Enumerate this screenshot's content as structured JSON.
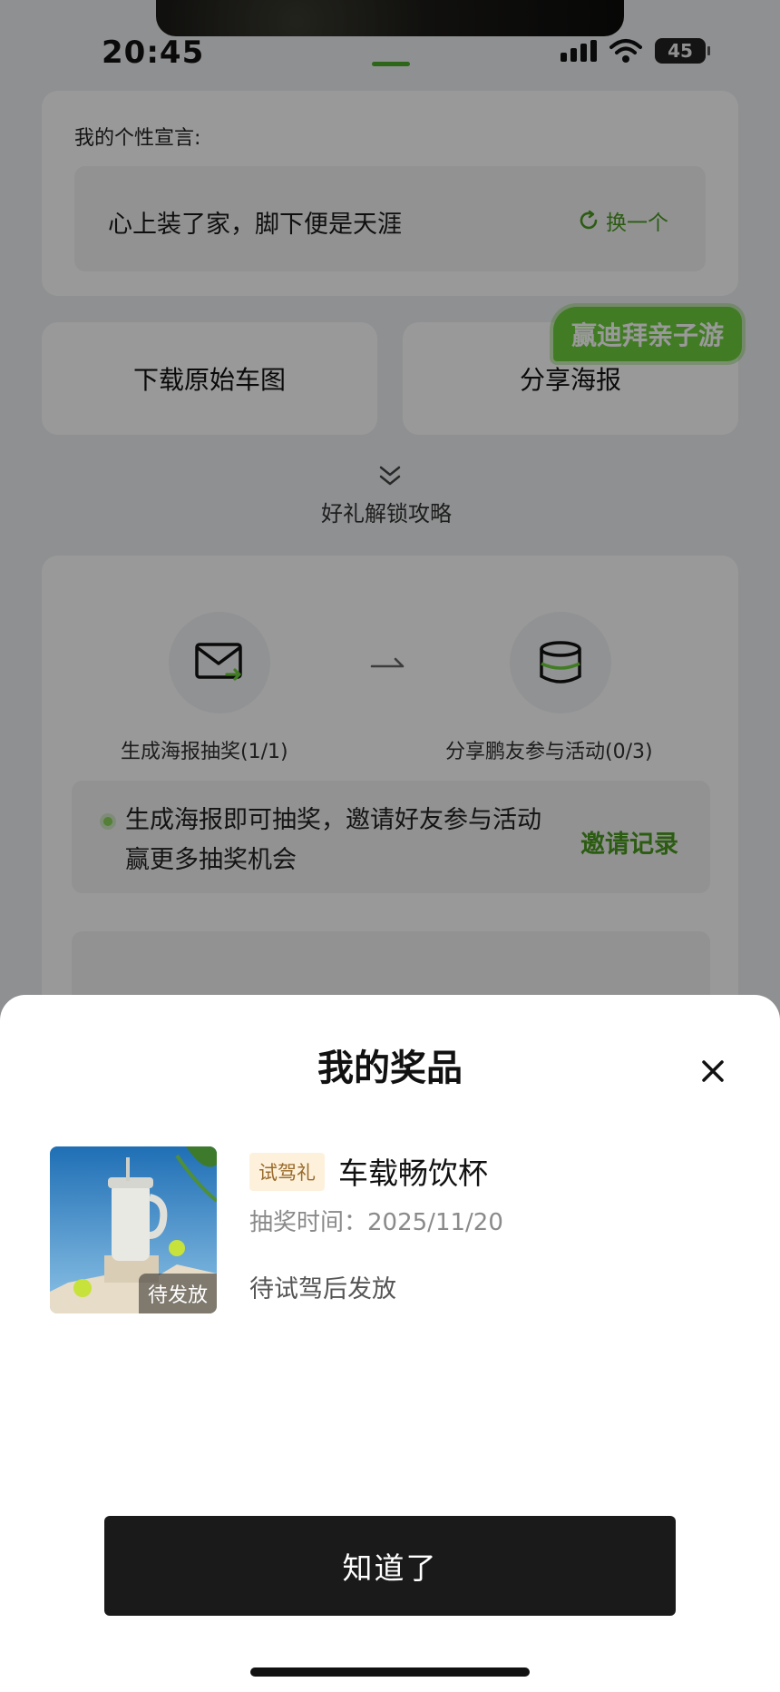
{
  "status_bar": {
    "time": "20:45",
    "battery": "45"
  },
  "motto": {
    "label": "我的个性宣言:",
    "text": "心上装了家，脚下便是天涯",
    "swap_label": "换一个"
  },
  "actions": {
    "download_label": "下载原始车图",
    "share_label": "分享海报",
    "promo_tag": "赢迪拜亲子游"
  },
  "guide": {
    "title": "好礼解锁攻略"
  },
  "steps": [
    {
      "label": "生成海报抽奖(1/1)",
      "icon": "mail-icon"
    },
    {
      "label": "分享鹏友参与活动(0/3)",
      "icon": "database-icon"
    }
  ],
  "tip": {
    "line1": "生成海报即可抽奖，邀请好友参与活动",
    "line2": "赢更多抽奖机会",
    "invite_record": "邀请记录"
  },
  "sheet": {
    "title": "我的奖品",
    "prize": {
      "tag": "试驾礼",
      "name": "车载畅饮杯",
      "time_label": "抽奖时间：",
      "time_value": "2025/11/20",
      "status": "待试驾后发放",
      "badge": "待发放"
    },
    "ok_label": "知道了"
  },
  "colors": {
    "accent_green": "#4a9a1e",
    "promo_green": "#6dcf3c",
    "dark_button": "#1a1a1a"
  }
}
